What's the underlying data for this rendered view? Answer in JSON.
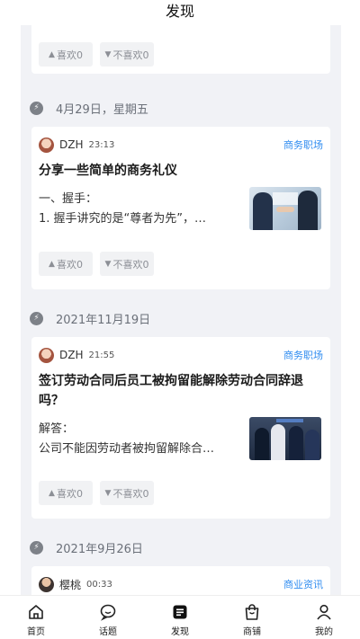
{
  "page": {
    "title": "发现"
  },
  "reactions": {
    "like": "喜欢0",
    "dislike": "不喜欢0"
  },
  "groups": [
    {
      "date": "4月29日，星期五"
    },
    {
      "date": "2021年11月19日"
    },
    {
      "date": "2021年9月26日"
    }
  ],
  "posts": [
    {
      "author": "DZH",
      "time": "23:13",
      "tag": "商务职场",
      "title": "分享一些简单的商务礼仪",
      "excerpt_line1": "一、握手：",
      "excerpt_line2": "1. 握手讲究的是“尊者为先”，…",
      "image": "handshake-photo"
    },
    {
      "author": "DZH",
      "time": "21:55",
      "tag": "商务职场",
      "title": "签订劳动合同后员工被拘留能解除劳动合同辞退吗？",
      "excerpt_line1": "解答：",
      "excerpt_line2": "公司不能因劳动者被拘留解除合…",
      "image": "police-photo"
    },
    {
      "author": "樱桃",
      "time": "00:33",
      "tag": "商业资讯"
    }
  ],
  "tabbar": [
    {
      "label": "首页",
      "icon": "home-icon"
    },
    {
      "label": "话题",
      "icon": "chat-icon"
    },
    {
      "label": "发现",
      "icon": "discover-icon",
      "active": true
    },
    {
      "label": "商铺",
      "icon": "shop-bag-icon"
    },
    {
      "label": "我的",
      "icon": "user-icon"
    }
  ],
  "colors": {
    "accent": "#2f8cf0",
    "feed_bg": "#f1f2f6"
  }
}
